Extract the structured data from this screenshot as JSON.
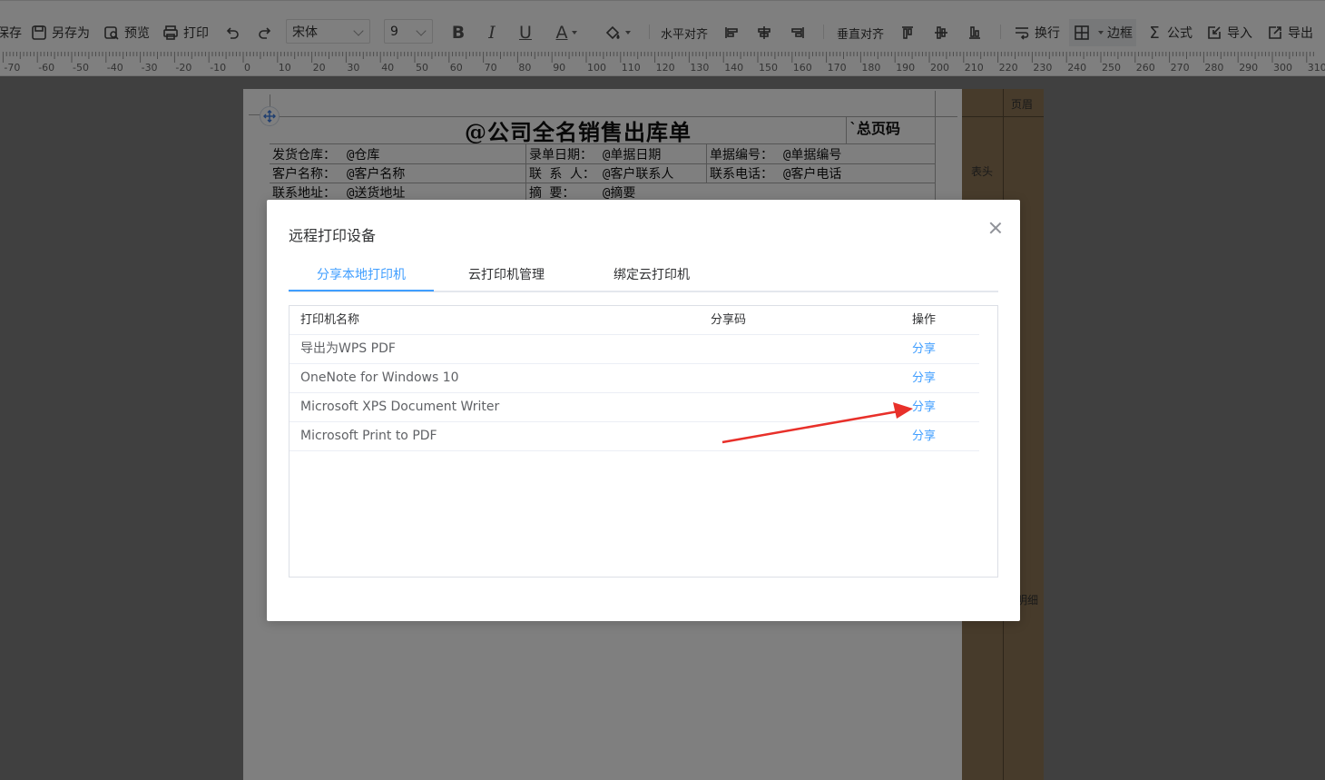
{
  "toolbar": {
    "save": "保存",
    "save_as": "另存为",
    "preview": "预览",
    "print": "打印",
    "font_family": "宋体",
    "font_size": "9",
    "bold": "B",
    "italic": "I",
    "underline": "U",
    "font_color": "A",
    "halign_label": "水平对齐",
    "valign_label": "垂直对齐",
    "wrap": "换行",
    "border": "边框",
    "formula": "公式",
    "import": "导入",
    "export": "导出"
  },
  "ruler": {
    "labels": [
      "-70",
      "-60",
      "-50",
      "-40",
      "-30",
      "-20",
      "-10",
      "0",
      "10",
      "20",
      "30",
      "40",
      "50",
      "60",
      "70",
      "80",
      "90",
      "100",
      "110",
      "120",
      "130",
      "140",
      "150",
      "160",
      "170",
      "180",
      "190",
      "200",
      "210",
      "220",
      "230",
      "240",
      "250",
      "260",
      "270",
      "280",
      "290",
      "300",
      "310"
    ]
  },
  "bands": {
    "header": "页眉",
    "table_header": "表头",
    "detail": "明细"
  },
  "document": {
    "title": "@公司全名销售出库单",
    "page_total": "`总页码",
    "rows": [
      [
        "发货仓库：",
        "@仓库",
        "录单日期：",
        "@单据日期",
        "单据编号：",
        "@单据编号"
      ],
      [
        "客户名称：",
        "@客户名称",
        "联 系 人：",
        "@客户联系人",
        "联系电话：",
        "@客户电话"
      ],
      [
        "联系地址：",
        "@送货地址",
        "摘    要：",
        "@摘要",
        "",
        ""
      ]
    ]
  },
  "dialog": {
    "title": "远程打印设备",
    "tabs": [
      "分享本地打印机",
      "云打印机管理",
      "绑定云打印机"
    ],
    "active_tab": 0,
    "columns": [
      "打印机名称",
      "分享码",
      "操作"
    ],
    "rows": [
      {
        "name": "导出为WPS PDF",
        "code": "",
        "action": "分享"
      },
      {
        "name": "OneNote for Windows 10",
        "code": "",
        "action": "分享"
      },
      {
        "name": "Microsoft XPS Document Writer",
        "code": "",
        "action": "分享"
      },
      {
        "name": "Microsoft Print to PDF",
        "code": "",
        "action": "分享"
      }
    ]
  },
  "colors": {
    "accent": "#409eff",
    "band": "#8e7656",
    "annotation_arrow": "#e8302a"
  }
}
